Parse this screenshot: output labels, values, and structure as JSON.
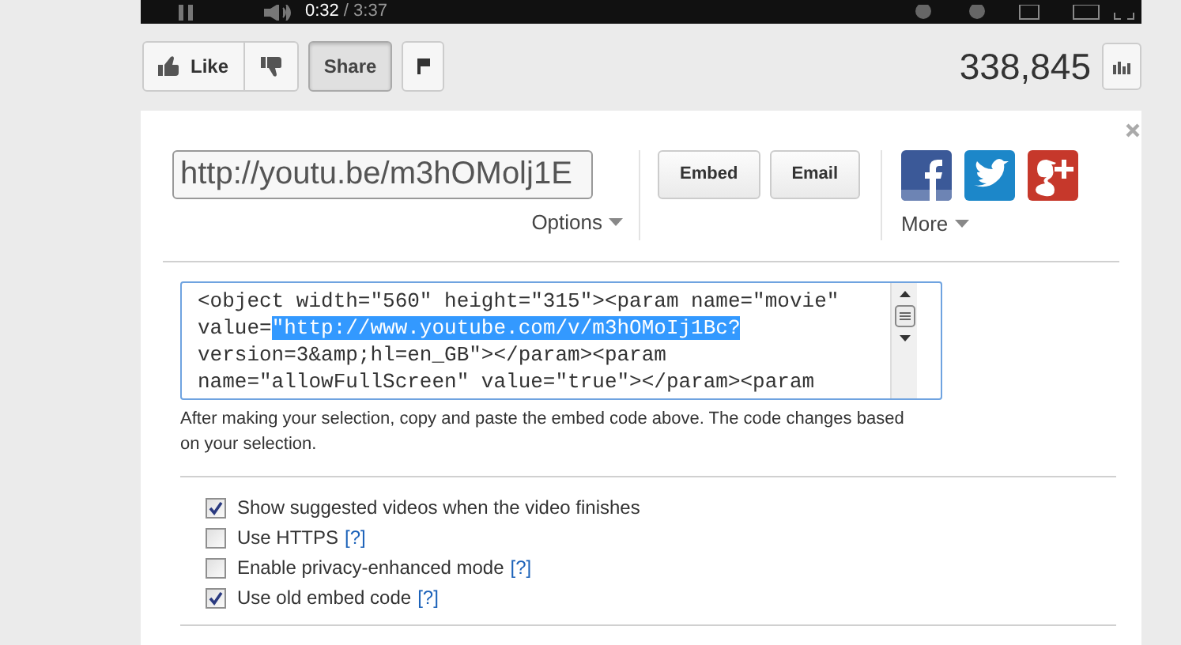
{
  "player": {
    "time_current": "0:32",
    "time_total": "/ 3:37"
  },
  "actions": {
    "like": "Like",
    "share": {
      "label": "Share",
      "selected": true
    },
    "view_count": "338,845"
  },
  "share_panel": {
    "url": "http://youtu.be/m3hOMolj1E",
    "options": "Options",
    "buttons": [
      "Embed",
      "Email"
    ],
    "more": "More",
    "embed_code": [
      {
        "text": "<object width=\"560\" height=\"315\"><param name=\"movie\" value=",
        "selected": false
      },
      {
        "text": "\"http://www.youtube.com/v/m3hOMoIj1Bc?",
        "selected": true
      },
      {
        "text": " version=3&amp;hl=en_GB\"></param><param name=\"allowFullScreen\" value=\"true\"></param><param",
        "selected": false
      }
    ],
    "help_text": "After making your selection, copy and paste the embed code above. The code changes based on your selection.",
    "options_list": [
      {
        "label": "Show suggested videos when the video finishes",
        "checked": true
      },
      {
        "label": "Use HTTPS",
        "help": "[?]",
        "checked": false
      },
      {
        "label": "Enable privacy-enhanced mode",
        "help": "[?]",
        "checked": false
      },
      {
        "label": "Use old embed code",
        "help": "[?]",
        "checked": true
      }
    ]
  }
}
